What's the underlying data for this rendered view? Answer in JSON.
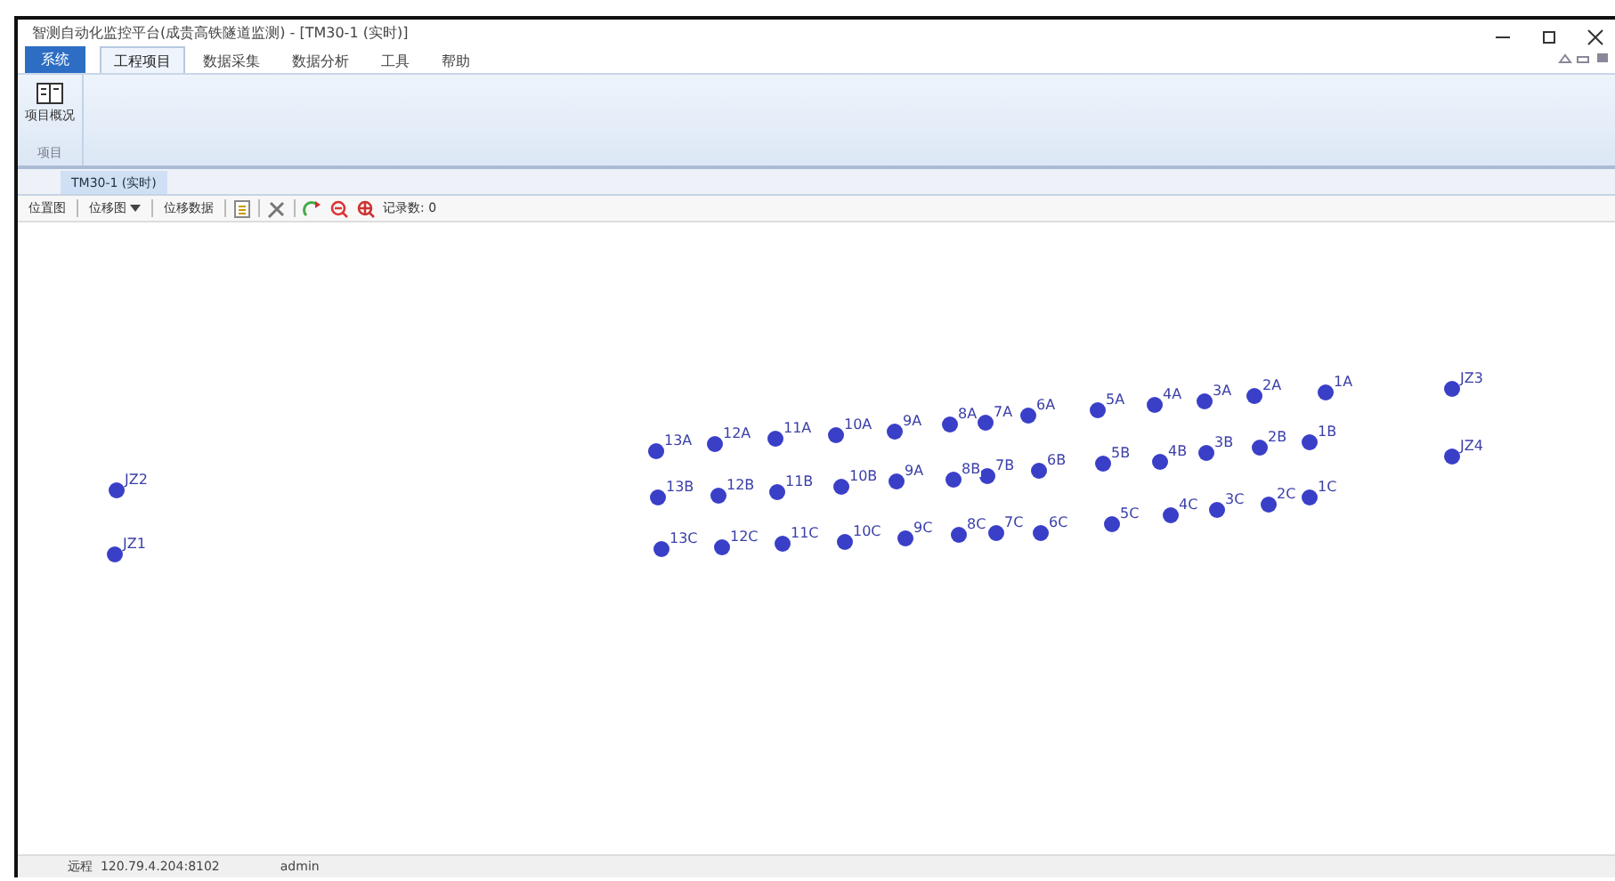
{
  "window": {
    "title": "智测自动化监控平台(成贵高铁隧道监测) - [TM30-1 (实时)]"
  },
  "menu": [
    {
      "label": "系统",
      "kind": "app"
    },
    {
      "label": "工程项目",
      "kind": "tab",
      "selected": true
    },
    {
      "label": "数据采集",
      "kind": "tab",
      "selected": false
    },
    {
      "label": "数据分析",
      "kind": "tab",
      "selected": false
    },
    {
      "label": "工具",
      "kind": "tab",
      "selected": false
    },
    {
      "label": "帮助",
      "kind": "tab",
      "selected": false
    }
  ],
  "ribbon": {
    "buttons": [
      "项目概况"
    ],
    "group": "项目"
  },
  "document_tabs": [
    {
      "label": "TM30-1 (实时)",
      "selected": true
    }
  ],
  "toolbar": {
    "buttons": [
      {
        "label": "位置图",
        "kind": "text"
      },
      {
        "label": "位移图",
        "kind": "dropdown"
      },
      {
        "label": "位移数据",
        "kind": "text"
      },
      {
        "kind": "icon"
      },
      {
        "kind": "icon"
      },
      {
        "kind": "icon"
      },
      {
        "kind": "icon"
      },
      {
        "kind": "icon"
      }
    ],
    "record_count": "记录数: 0"
  },
  "points": [
    "13A",
    "12A",
    "11A",
    "10A",
    "9A",
    "8A",
    "7A",
    "6A",
    "5A",
    "4A",
    "3A",
    "2A",
    "1A",
    "13B",
    "12B",
    "11B",
    "10B",
    "9A",
    "8B",
    "7B",
    "6B",
    "5B",
    "4B",
    "3B",
    "2B",
    "1B",
    "13C",
    "12C",
    "11C",
    "10C",
    "9C",
    "8C",
    "7C",
    "6C",
    "5C",
    "4C",
    "3C",
    "2C",
    "1C",
    "JZ3",
    "JZ4",
    "JZ2",
    "JZ1"
  ],
  "status_bar": [
    "远程  120.79.4.204:8102",
    "admin"
  ]
}
